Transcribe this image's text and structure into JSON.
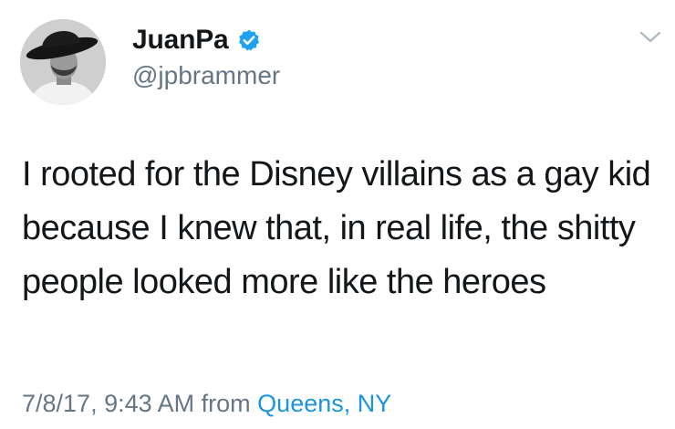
{
  "author": {
    "display_name": "JuanPa",
    "handle": "@jpbrammer",
    "verified": true,
    "verified_icon": "verified-badge-icon",
    "avatar_icon": "avatar-photo"
  },
  "menu": {
    "icon": "chevron-down-icon"
  },
  "tweet": {
    "text": "I rooted for the Disney villains as a gay kid because I knew that, in real life, the shitty people looked more like the heroes"
  },
  "meta": {
    "timestamp": "7/8/17, 9:43 AM",
    "from_label": "from",
    "location": "Queens, NY"
  },
  "colors": {
    "text": "#14171a",
    "secondary": "#657786",
    "link": "#1b95e0",
    "verified": "#1da1f2"
  }
}
